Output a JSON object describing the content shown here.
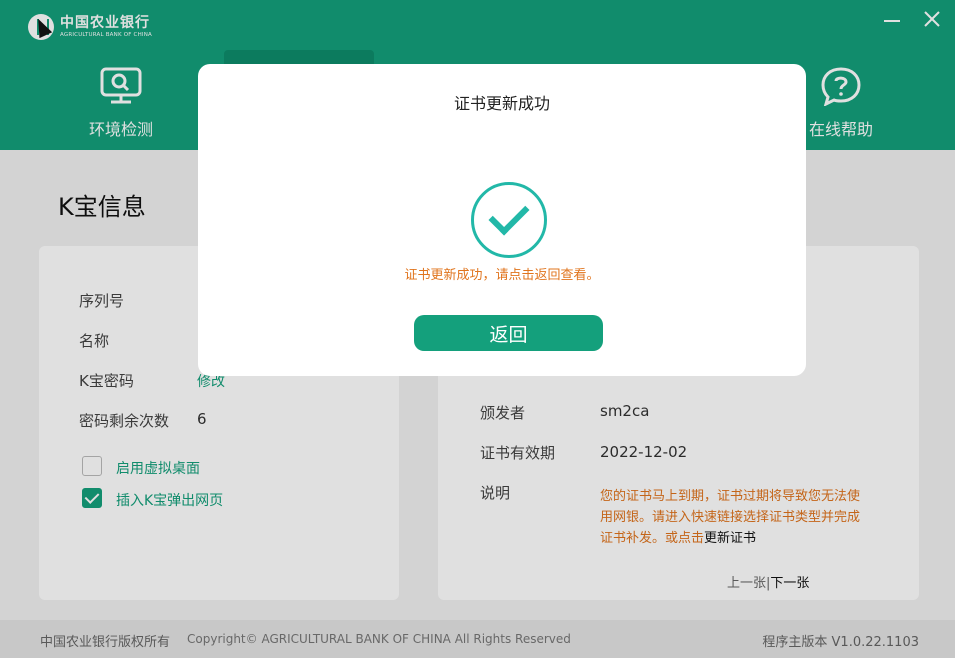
{
  "app": {
    "logo_cn": "中国农业银行",
    "logo_en": "AGRICULTURAL BANK OF CHINA"
  },
  "nav": {
    "items": [
      {
        "label": "环境检测",
        "icon": "monitor-icon"
      },
      {
        "label": "在线帮助",
        "icon": "help-icon"
      }
    ]
  },
  "page": {
    "title": "K宝信息"
  },
  "left_card": {
    "fields": [
      {
        "label": "序列号",
        "value": ""
      },
      {
        "label": "名称",
        "value": ""
      },
      {
        "label": "K宝密码",
        "value": "修改"
      },
      {
        "label": "密码剩余次数",
        "value": "6"
      }
    ],
    "checkboxes": [
      {
        "label": "启用虚拟桌面",
        "checked": false
      },
      {
        "label": "插入K宝弹出网页",
        "checked": true
      }
    ]
  },
  "right_card": {
    "fields": [
      {
        "label": "颁发者",
        "value": "sm2ca"
      },
      {
        "label": "证书有效期",
        "value": "2022-12-02"
      },
      {
        "label": "说明",
        "value": ""
      }
    ],
    "description": "您的证书马上到期，证书过期将导致您无法使用网银。请进入快速链接选择证书类型并完成证书补发。或点击",
    "description_link": "更新证书",
    "pager_prev": "上一张",
    "pager_sep": "|",
    "pager_next": "下一张"
  },
  "footer": {
    "owner": "中国农业银行版权所有",
    "copyright": "Copyright© AGRICULTURAL BANK OF CHINA All Rights Reserved",
    "version": "程序主版本 V1.0.22.1103"
  },
  "modal": {
    "title": "证书更新成功",
    "message": "证书更新成功，请点击返回查看。",
    "button": "返回"
  },
  "colors": {
    "brand_green": "#14a07c",
    "warning_orange": "#e0741d",
    "success_teal": "#22b8a8"
  }
}
